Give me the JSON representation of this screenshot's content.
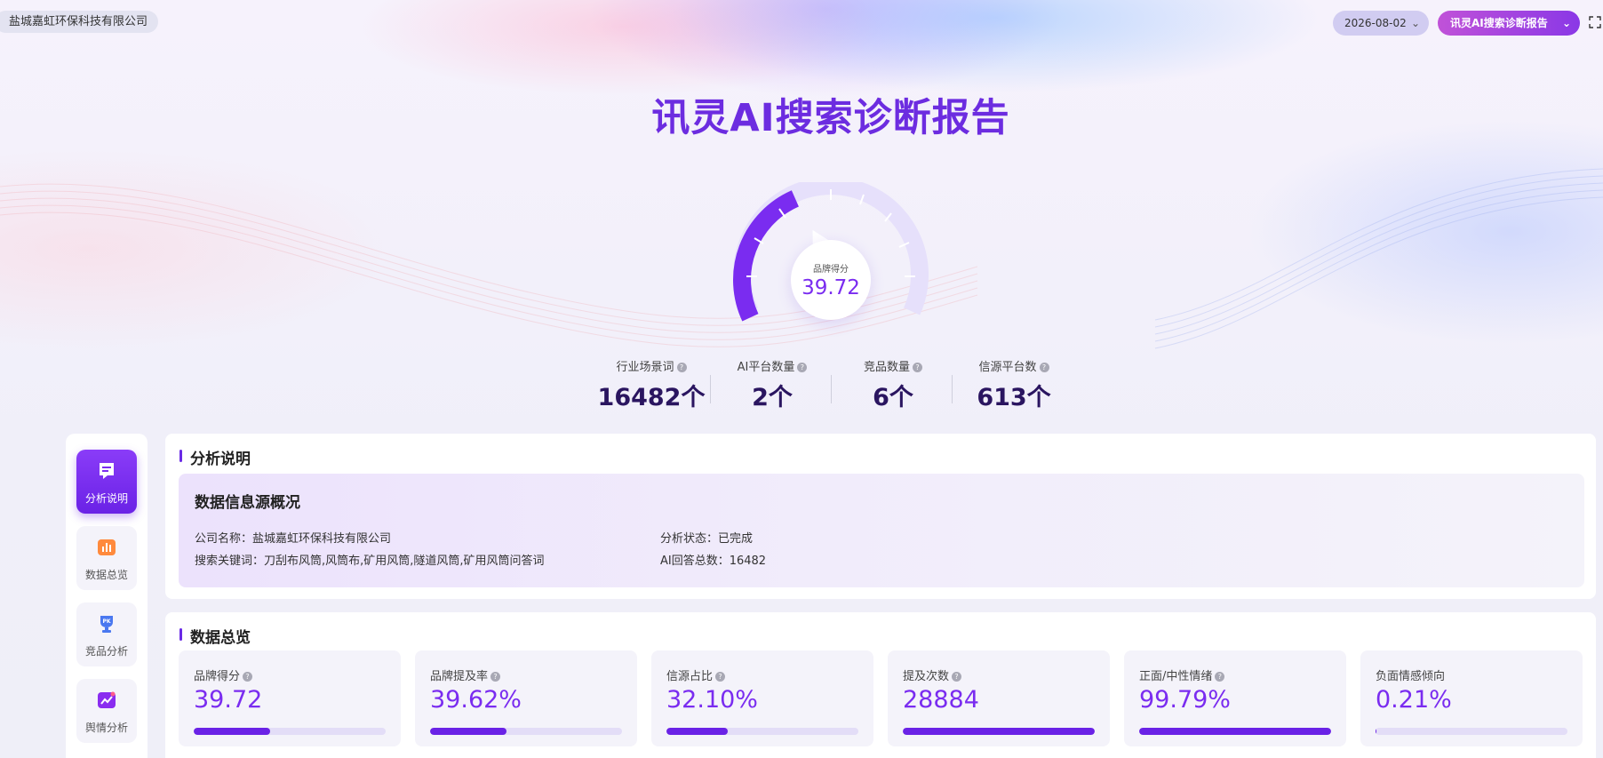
{
  "header": {
    "company": "盐城嘉虹环保科技有限公司",
    "date": "2026-08-02",
    "report_selector": "讯灵AI搜索诊断报告"
  },
  "title": "讯灵AI搜索诊断报告",
  "gauge": {
    "label": "品牌得分",
    "value": "39.72",
    "fraction": 0.3972
  },
  "stats": [
    {
      "label": "行业场景词",
      "value": "16482个"
    },
    {
      "label": "AI平台数量",
      "value": "2个"
    },
    {
      "label": "竞品数量",
      "value": "6个"
    },
    {
      "label": "信源平台数",
      "value": "613个"
    }
  ],
  "sidebar": {
    "items": [
      {
        "label": "分析说明",
        "icon": "doc-icon",
        "active": true
      },
      {
        "label": "数据总览",
        "icon": "bar-chart-icon",
        "active": false
      },
      {
        "label": "竞品分析",
        "icon": "trophy-icon",
        "active": false
      },
      {
        "label": "舆情分析",
        "icon": "trend-icon",
        "active": false
      }
    ]
  },
  "analysis": {
    "section_title": "分析说明",
    "box_title": "数据信息源概况",
    "company_label": "公司名称：盐城嘉虹环保科技有限公司",
    "keywords_label": "搜索关键词：刀刮布风筒,风筒布,矿用风筒,隧道风筒,矿用风筒问答词",
    "status_label": "分析状态：已完成",
    "answers_label": "AI回答总数：16482"
  },
  "overview": {
    "section_title": "数据总览",
    "metrics": [
      {
        "label": "品牌得分",
        "value": "39.72",
        "progress": 0.3972,
        "has_help": true
      },
      {
        "label": "品牌提及率",
        "value": "39.62%",
        "progress": 0.3962,
        "has_help": true
      },
      {
        "label": "信源占比",
        "value": "32.10%",
        "progress": 0.321,
        "has_help": true
      },
      {
        "label": "提及次数",
        "value": "28884",
        "progress": 1.0,
        "has_help": true
      },
      {
        "label": "正面/中性情绪",
        "value": "99.79%",
        "progress": 0.9979,
        "has_help": true
      },
      {
        "label": "负面情感倾向",
        "value": "0.21%",
        "progress": 0.0021,
        "has_help": false
      }
    ]
  },
  "colors": {
    "accent": "#6a22e6",
    "title": "#6c2ce0",
    "stat_value": "#2a1560"
  }
}
